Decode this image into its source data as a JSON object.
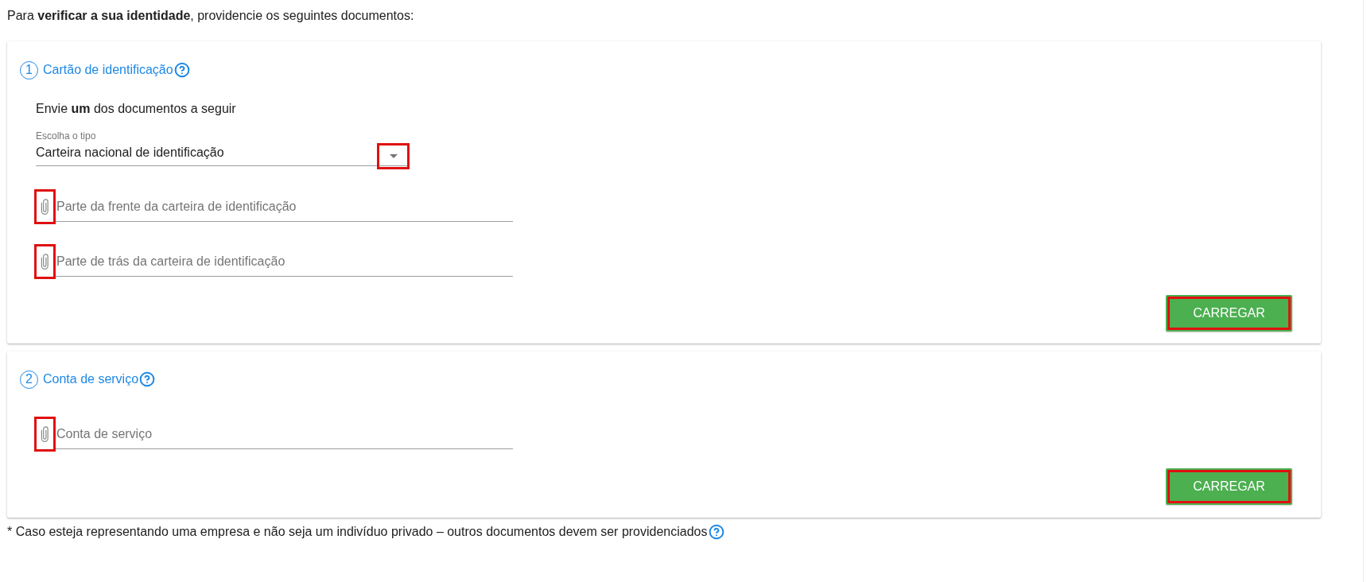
{
  "intro": "Para **verificar a sua identidade**, providencie os seguintes documentos:",
  "sections": [
    {
      "number": "1",
      "title": "Cartão de identificação",
      "instruction": "Envie **um** dos documentos a seguir",
      "select": {
        "label": "Escolha o tipo",
        "value": "Carteira nacional de identificação",
        "arrow_highlighted": true
      },
      "files": [
        {
          "placeholder": "Parte da frente da carteira de identificação",
          "highlighted": true
        },
        {
          "placeholder": "Parte de trás da carteira de identificação",
          "highlighted": true
        }
      ],
      "button": {
        "label": "CARREGAR",
        "highlighted": true
      }
    },
    {
      "number": "2",
      "title": "Conta de serviço",
      "files": [
        {
          "placeholder": "Conta de serviço",
          "highlighted": true
        }
      ],
      "button": {
        "label": "CARREGAR",
        "highlighted": true
      }
    }
  ],
  "footnote": "* Caso esteja representando uma empresa e não seja um indivíduo privado – outros documentos devem ser providenciados"
}
